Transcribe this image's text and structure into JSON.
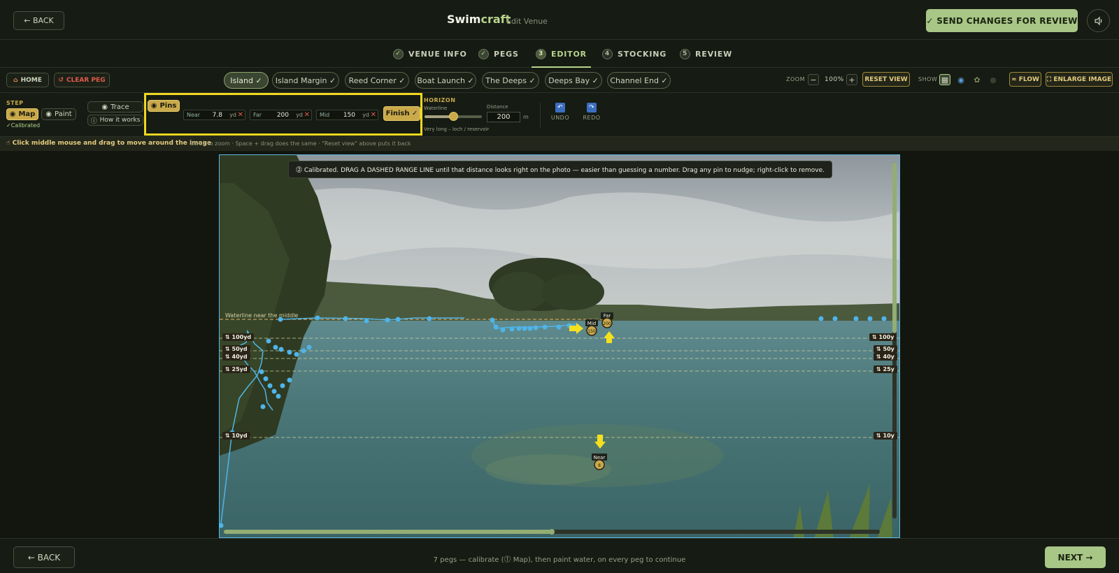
{
  "topbar": {
    "back_label": "← BACK",
    "brand_main": "Swim",
    "brand_accent": "craft",
    "subtitle": "Edit Venue",
    "send_label": "✓ SEND CHANGES FOR REVIEW",
    "sound_icon": "speaker-icon"
  },
  "steps": [
    {
      "num": "✓",
      "label": "VENUE INFO",
      "state": "done"
    },
    {
      "num": "✓",
      "label": "PEGS",
      "state": "done"
    },
    {
      "num": "3",
      "label": "EDITOR",
      "state": "active"
    },
    {
      "num": "4",
      "label": "STOCKING",
      "state": "todo"
    },
    {
      "num": "5",
      "label": "REVIEW",
      "state": "todo"
    }
  ],
  "pegbar": {
    "home_label": "HOME",
    "clear_label": "CLEAR PEG",
    "pegs": [
      "Island ✓",
      "Island Margin ✓",
      "Reed Corner ✓",
      "Boat Launch ✓",
      "The Deeps ✓",
      "Deeps Bay ✓",
      "Channel End ✓"
    ],
    "active_peg": "Island ✓",
    "zoom_label": "ZOOM",
    "zoom_minus": "−",
    "zoom_value": "100%",
    "zoom_plus": "+",
    "reset_view": "RESET VIEW",
    "show_label": "SHOW",
    "flow_label": "≈ FLOW",
    "enlarge_label": "⛶ ENLARGE IMAGE"
  },
  "toolbar": {
    "step_label": "STEP",
    "map_label": "Map",
    "paint_label": "Paint",
    "calibrated": "✓Calibrated",
    "trace_label": "Trace",
    "how_label": "How it works",
    "pins_label": "Pins",
    "near": {
      "label": "Near",
      "value": "7.8",
      "unit": "yd"
    },
    "far": {
      "label": "Far",
      "value": "200",
      "unit": "yd"
    },
    "mid": {
      "label": "Mid",
      "value": "150",
      "unit": "yd"
    },
    "finish_label": "Finish ✓",
    "horizon_label": "HORIZON",
    "waterline_label": "Waterline",
    "waterline_value": 0.5,
    "waterline_caption": "Very long – loch / reservoir",
    "distance_label": "Distance",
    "distance_value": "200",
    "distance_unit": "m",
    "undo_label": "UNDO",
    "redo_label": "REDO"
  },
  "hint": {
    "main": "Click middle mouse and drag to move around the image",
    "sub": "Scroll to zoom · Space + drag does the same · \"Reset view\" above puts it back"
  },
  "canvas": {
    "tooltip": "⓶ Calibrated. DRAG A DASHED RANGE LINE until that distance looks right on the photo — easier than guessing a number. Drag any pin to nudge; right-click to remove.",
    "waterline_text": "Waterline near the middle",
    "range_lines": [
      "100yd",
      "50yd",
      "40yd",
      "25yd",
      "10yd"
    ],
    "range_lines_right": [
      "100y",
      "50y",
      "40y",
      "25y",
      "10y"
    ],
    "pins": {
      "far": "Far",
      "mid": "Mid",
      "near": "Near"
    },
    "pin_badges": {
      "far": "200",
      "mid": "150",
      "near": "8"
    },
    "horizontal_scroll": 0.5,
    "vertical_scroll": 0.48
  },
  "bottombar": {
    "back_label": "← BACK",
    "status": "7 pegs — calibrate (⓵ Map), then paint water, on every peg to continue",
    "next_label": "NEXT →"
  },
  "colors": {
    "accent_green": "#a8c686",
    "gold": "#c9a94a",
    "highlight": "#f0d820",
    "outline_blue": "#5fb8e8",
    "pin_yellow": "#f5e020"
  }
}
